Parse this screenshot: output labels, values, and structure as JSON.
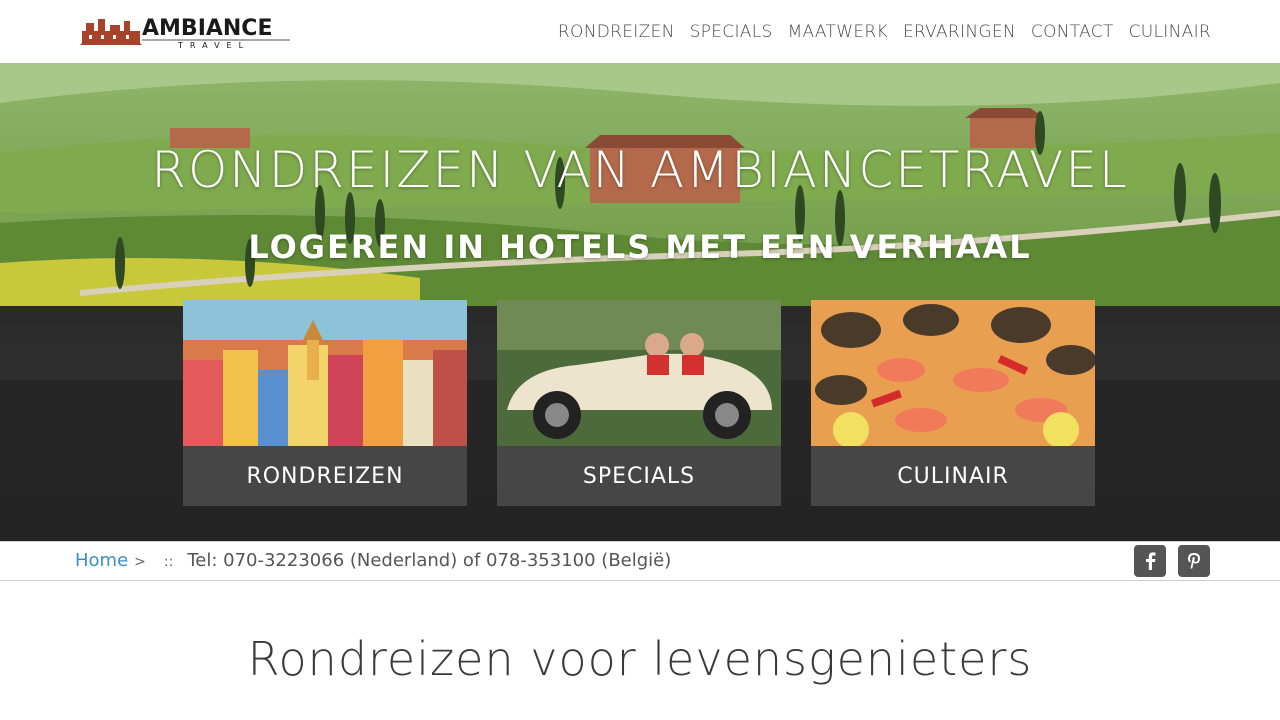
{
  "header": {
    "logo_text": "AMBIANCE",
    "logo_subtext": "TRAVEL",
    "nav": [
      "RONDREIZEN",
      "SPECIALS",
      "MAATWERK",
      "ERVARINGEN",
      "CONTACT",
      "CULINAIR"
    ]
  },
  "hero": {
    "title": "RONDREIZEN VAN AMBIANCETRAVEL",
    "subtitle": "LOGEREN IN HOTELS MET EEN VERHAAL"
  },
  "cards": [
    {
      "label": "RONDREIZEN"
    },
    {
      "label": "SPECIALS"
    },
    {
      "label": "CULINAIR"
    }
  ],
  "breadcrumb": {
    "home": "Home",
    "separator": ">",
    "divider": "::",
    "phone": "Tel: 070-3223066 (Nederland) of 078-353100 (België)"
  },
  "social": [
    {
      "icon": "facebook-icon",
      "glyph": "f"
    },
    {
      "icon": "pinterest-icon",
      "glyph": "P"
    }
  ],
  "intro": {
    "title": "Rondreizen voor levensgenieters"
  },
  "colors": {
    "link": "#3a8fc4",
    "card_bg": "#464646",
    "social_bg": "#555555"
  }
}
